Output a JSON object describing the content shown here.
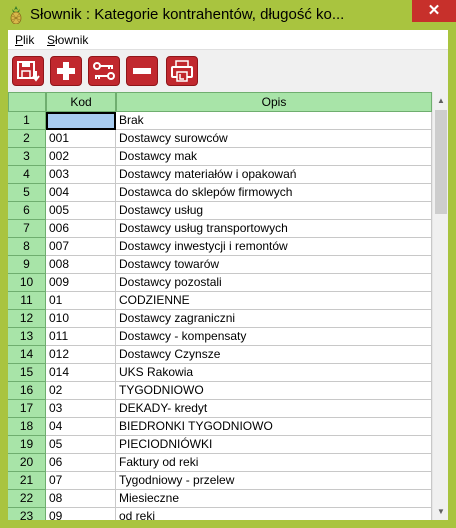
{
  "window": {
    "title": "Słownik : Kategorie kontrahentów,  długość ko...",
    "close_label": "✕",
    "app_icon": "pineapple-icon"
  },
  "menu": {
    "items": [
      {
        "label": "Plik",
        "underline": "P"
      },
      {
        "label": "Słownik",
        "underline": "S"
      }
    ]
  },
  "toolbar": {
    "buttons": [
      {
        "icon": "save-import-icon"
      },
      {
        "icon": "add-icon"
      },
      {
        "icon": "key-link-icon"
      },
      {
        "icon": "remove-icon"
      },
      {
        "icon": "print-icon"
      }
    ]
  },
  "grid": {
    "columns": [
      "",
      "Kod",
      "Opis"
    ],
    "rows": [
      {
        "num": "1",
        "kod": "",
        "opis": "Brak"
      },
      {
        "num": "2",
        "kod": "001",
        "opis": "Dostawcy surowców"
      },
      {
        "num": "3",
        "kod": "002",
        "opis": "Dostawcy mak"
      },
      {
        "num": "4",
        "kod": "003",
        "opis": "Dostawcy materiałów i opakowań"
      },
      {
        "num": "5",
        "kod": "004",
        "opis": "Dostawca do sklepów firmowych"
      },
      {
        "num": "6",
        "kod": "005",
        "opis": "Dostawcy usług"
      },
      {
        "num": "7",
        "kod": "006",
        "opis": "Dostawcy usług transportowych"
      },
      {
        "num": "8",
        "kod": "007",
        "opis": "Dostawcy inwestycji i remontów"
      },
      {
        "num": "9",
        "kod": "008",
        "opis": "Dostawcy towarów"
      },
      {
        "num": "10",
        "kod": "009",
        "opis": "Dostawcy pozostali"
      },
      {
        "num": "11",
        "kod": "01",
        "opis": "CODZIENNE"
      },
      {
        "num": "12",
        "kod": "010",
        "opis": "Dostawcy zagraniczni"
      },
      {
        "num": "13",
        "kod": "011",
        "opis": "Dostawcy - kompensaty"
      },
      {
        "num": "14",
        "kod": "012",
        "opis": "Dostawcy  Czynsze"
      },
      {
        "num": "15",
        "kod": "014",
        "opis": "UKS Rakowia"
      },
      {
        "num": "16",
        "kod": "02",
        "opis": "TYGODNIOWO"
      },
      {
        "num": "17",
        "kod": "03",
        "opis": "DEKADY- kredyt"
      },
      {
        "num": "18",
        "kod": "04",
        "opis": "BIEDRONKI TYGODNIOWO"
      },
      {
        "num": "19",
        "kod": "05",
        "opis": "PIECIODNIÓWKI"
      },
      {
        "num": "20",
        "kod": "06",
        "opis": "Faktury od reki"
      },
      {
        "num": "21",
        "kod": "07",
        "opis": "Tygodniowy - przelew"
      },
      {
        "num": "22",
        "kod": "08",
        "opis": "Miesieczne"
      },
      {
        "num": "23",
        "kod": "09",
        "opis": "od reki"
      }
    ],
    "selected_row": 0
  },
  "colors": {
    "frame": "#a9c43f",
    "header_green": "#a8e4a8",
    "toolbar_red": "#c1282e",
    "selection_blue": "#a8ccf0"
  }
}
